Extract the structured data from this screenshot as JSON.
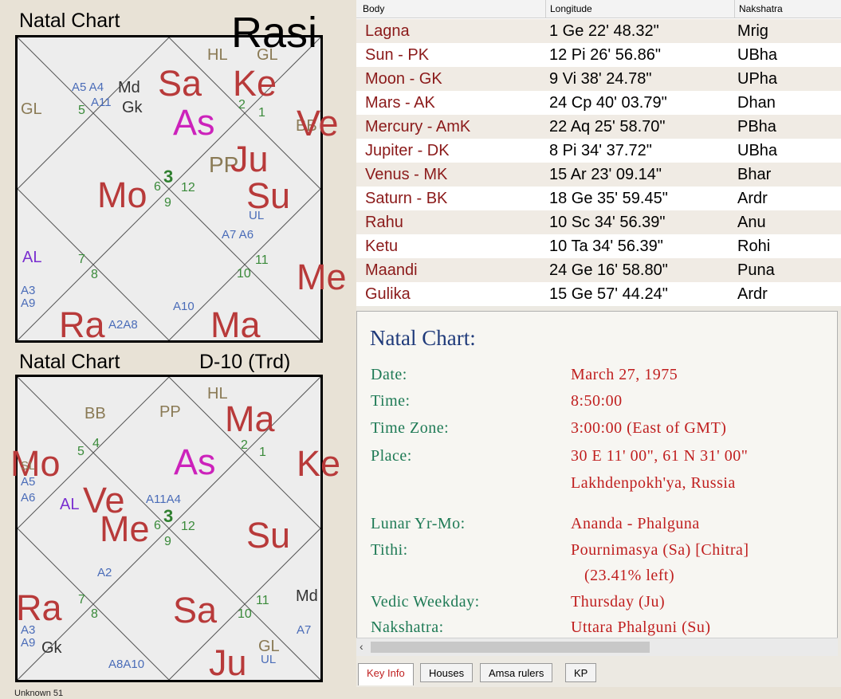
{
  "rasi_chart": {
    "title": "Natal Chart",
    "name": "Rasi",
    "cells": {
      "gl": "GL",
      "a5a4": "A5 A4",
      "a11": "A11",
      "md": "Md",
      "gk": "Gk",
      "num5": "5",
      "sa": "Sa",
      "as": "As",
      "hl": "HL",
      "gl2": "GL",
      "ke": "Ke",
      "num2": "2",
      "num1": "1",
      "ve": "Ve",
      "bb": "BB",
      "mo": "Mo",
      "num6": "6",
      "num3": "3",
      "num12": "12",
      "num9": "9",
      "pp": "PP",
      "ju": "Ju",
      "su": "Su",
      "ul": "UL",
      "a7a6": "A7 A6",
      "al": "AL",
      "a3": "A3",
      "a9": "A9",
      "num7": "7",
      "num8": "8",
      "num11": "11",
      "num10": "10",
      "me": "Me",
      "ra": "Ra",
      "a2a8": "A2A8",
      "a10": "A10",
      "ma": "Ma"
    }
  },
  "d10_chart": {
    "title": "Natal Chart",
    "name": "D-10 (Trd)",
    "cells": {
      "bb": "BB",
      "pp": "PP",
      "hl": "HL",
      "ma": "Ma",
      "num2": "2",
      "num1": "1",
      "ke": "Ke",
      "mo": "Mo",
      "sl": "SL",
      "a5": "A5",
      "a6": "A6",
      "num5": "5",
      "num4": "4",
      "as": "As",
      "al": "AL",
      "ve": "Ve",
      "a11a4": "A11A4",
      "me": "Me",
      "num6": "6",
      "num3": "3",
      "num12": "12",
      "num9": "9",
      "su": "Su",
      "a2": "A2",
      "ra": "Ra",
      "num7": "7",
      "num8": "8",
      "sa": "Sa",
      "num11": "11",
      "num10": "10",
      "md": "Md",
      "a7": "A7",
      "a3": "A3",
      "a9": "A9",
      "gk": "Gk",
      "a8a10": "A8A10",
      "ju": "Ju",
      "gl": "GL",
      "ul": "UL"
    }
  },
  "table": {
    "headers": [
      "Body",
      "Longitude",
      "Nakshatra"
    ],
    "rows": [
      {
        "body": "Lagna",
        "longitude": "1 Ge 22' 48.32\"",
        "nakshatra": "Mrig"
      },
      {
        "body": "Sun - PK",
        "longitude": "12 Pi 26' 56.86\"",
        "nakshatra": "UBha"
      },
      {
        "body": "Moon - GK",
        "longitude": "9 Vi 38' 24.78\"",
        "nakshatra": "UPha"
      },
      {
        "body": "Mars - AK",
        "longitude": "24 Cp 40' 03.79\"",
        "nakshatra": "Dhan"
      },
      {
        "body": "Mercury - AmK",
        "longitude": "22 Aq 25' 58.70\"",
        "nakshatra": "PBha"
      },
      {
        "body": "Jupiter - DK",
        "longitude": "8 Pi 34' 37.72\"",
        "nakshatra": "UBha"
      },
      {
        "body": "Venus - MK",
        "longitude": "15 Ar 23' 09.14\"",
        "nakshatra": "Bhar"
      },
      {
        "body": "Saturn - BK",
        "longitude": "18 Ge 35' 59.45\"",
        "nakshatra": "Ardr"
      },
      {
        "body": "Rahu",
        "longitude": "10 Sc 34' 56.39\"",
        "nakshatra": "Anu"
      },
      {
        "body": "Ketu",
        "longitude": "10 Ta 34' 56.39\"",
        "nakshatra": "Rohi"
      },
      {
        "body": "Maandi",
        "longitude": "24 Ge 16' 58.80\"",
        "nakshatra": "Puna"
      },
      {
        "body": "Gulika",
        "longitude": "15 Ge 57' 44.24\"",
        "nakshatra": "Ardr"
      }
    ]
  },
  "info": {
    "title": "Natal Chart:",
    "date_label": "Date:",
    "date": "March 27, 1975",
    "time_label": "Time:",
    "time": "8:50:00",
    "tz_label": "Time Zone:",
    "tz": "3:00:00 (East of GMT)",
    "place_label": "Place:",
    "place_coords": "30 E 11' 00\", 61 N 31' 00\"",
    "place_name": "Lakhdenpokh'ya, Russia",
    "lunar_label": "Lunar Yr-Mo:",
    "lunar": "Ananda - Phalguna",
    "tithi_label": "Tithi:",
    "tithi": "Pournimasya (Sa) [Chitra]",
    "tithi_left": "(23.41% left)",
    "weekday_label": "Vedic Weekday:",
    "weekday": "Thursday (Ju)",
    "nakshatra_label": "Nakshatra:",
    "nakshatra": "Uttara Phalguni (Su)"
  },
  "tabs": [
    "Key Info",
    "Houses",
    "Amsa rulers",
    "KP"
  ],
  "status": "Unknown 51"
}
